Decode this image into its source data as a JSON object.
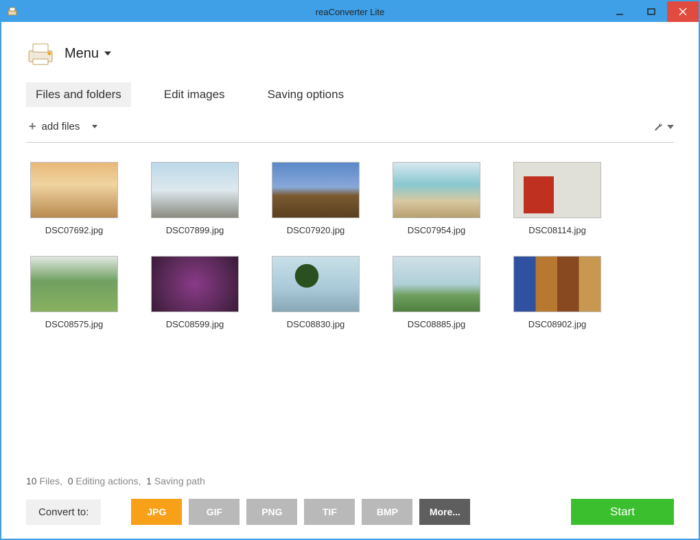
{
  "window": {
    "title": "reaConverter Lite"
  },
  "menu": {
    "label": "Menu"
  },
  "tabs": [
    {
      "label": "Files and folders",
      "active": true
    },
    {
      "label": "Edit images",
      "active": false
    },
    {
      "label": "Saving options",
      "active": false
    }
  ],
  "toolbar": {
    "add_files": "add files"
  },
  "files": [
    {
      "name": "DSC07692.jpg",
      "thumb": "g1"
    },
    {
      "name": "DSC07899.jpg",
      "thumb": "g2"
    },
    {
      "name": "DSC07920.jpg",
      "thumb": "g3"
    },
    {
      "name": "DSC07954.jpg",
      "thumb": "g4"
    },
    {
      "name": "DSC08114.jpg",
      "thumb": "g5"
    },
    {
      "name": "DSC08575.jpg",
      "thumb": "g6"
    },
    {
      "name": "DSC08599.jpg",
      "thumb": "g7"
    },
    {
      "name": "DSC08830.jpg",
      "thumb": "g8"
    },
    {
      "name": "DSC08885.jpg",
      "thumb": "g9"
    },
    {
      "name": "DSC08902.jpg",
      "thumb": "g10"
    }
  ],
  "status": {
    "files_count": "10",
    "files_label": "Files,",
    "actions_count": "0",
    "actions_label": "Editing actions,",
    "paths_count": "1",
    "paths_label": "Saving path"
  },
  "convert": {
    "label": "Convert to:",
    "formats": [
      {
        "label": "JPG",
        "active": true,
        "more": false
      },
      {
        "label": "GIF",
        "active": false,
        "more": false
      },
      {
        "label": "PNG",
        "active": false,
        "more": false
      },
      {
        "label": "TIF",
        "active": false,
        "more": false
      },
      {
        "label": "BMP",
        "active": false,
        "more": false
      },
      {
        "label": "More...",
        "active": false,
        "more": true
      }
    ],
    "start": "Start"
  }
}
